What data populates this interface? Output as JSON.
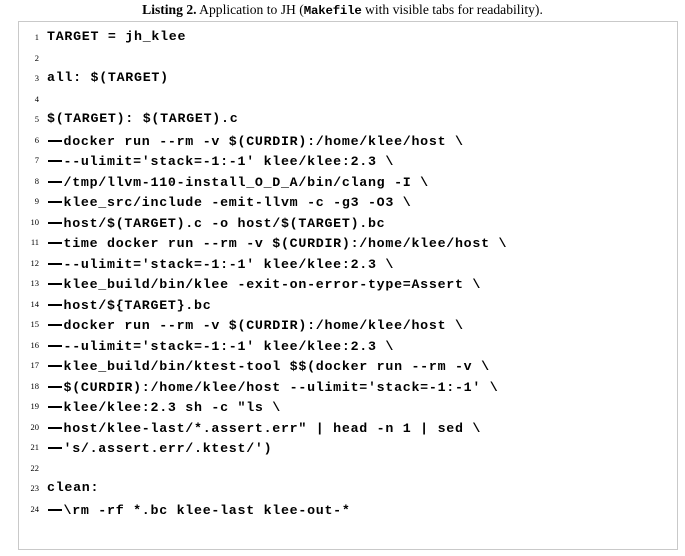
{
  "caption": {
    "label": "Listing 2.",
    "text_before_mono": " Application to JH (",
    "mono": "Makefile",
    "text_after_mono": " with visible tabs for readability)."
  },
  "listing": {
    "border_color": "#c9c9c9",
    "tab_glyph": "tab-marker",
    "lines": [
      {
        "n": "1",
        "tabs": 0,
        "text": "TARGET = jh_klee"
      },
      {
        "n": "2",
        "tabs": 0,
        "text": ""
      },
      {
        "n": "3",
        "tabs": 0,
        "text": "all: $(TARGET)"
      },
      {
        "n": "4",
        "tabs": 0,
        "text": ""
      },
      {
        "n": "5",
        "tabs": 0,
        "text": "$(TARGET): $(TARGET).c"
      },
      {
        "n": "6",
        "tabs": 1,
        "text": "docker run --rm -v $(CURDIR):/home/klee/host \\"
      },
      {
        "n": "7",
        "tabs": 1,
        "text": "--ulimit='stack=-1:-1' klee/klee:2.3 \\"
      },
      {
        "n": "8",
        "tabs": 1,
        "text": "/tmp/llvm-110-install_O_D_A/bin/clang -I \\"
      },
      {
        "n": "9",
        "tabs": 1,
        "text": "klee_src/include -emit-llvm -c -g3 -O3 \\"
      },
      {
        "n": "10",
        "tabs": 1,
        "text": "host/$(TARGET).c -o host/$(TARGET).bc"
      },
      {
        "n": "11",
        "tabs": 1,
        "text": "time docker run --rm -v $(CURDIR):/home/klee/host \\"
      },
      {
        "n": "12",
        "tabs": 1,
        "text": "--ulimit='stack=-1:-1' klee/klee:2.3 \\"
      },
      {
        "n": "13",
        "tabs": 1,
        "text": "klee_build/bin/klee -exit-on-error-type=Assert \\"
      },
      {
        "n": "14",
        "tabs": 1,
        "text": "host/${TARGET}.bc"
      },
      {
        "n": "15",
        "tabs": 1,
        "text": "docker run --rm -v $(CURDIR):/home/klee/host \\"
      },
      {
        "n": "16",
        "tabs": 1,
        "text": "--ulimit='stack=-1:-1' klee/klee:2.3 \\"
      },
      {
        "n": "17",
        "tabs": 1,
        "text": "klee_build/bin/ktest-tool $$(docker run --rm -v \\"
      },
      {
        "n": "18",
        "tabs": 1,
        "text": "$(CURDIR):/home/klee/host --ulimit='stack=-1:-1' \\"
      },
      {
        "n": "19",
        "tabs": 1,
        "text": "klee/klee:2.3 sh -c \"ls \\"
      },
      {
        "n": "20",
        "tabs": 1,
        "text": "host/klee-last/*.assert.err\" | head -n 1 | sed \\"
      },
      {
        "n": "21",
        "tabs": 1,
        "text": "'s/.assert.err/.ktest/')"
      },
      {
        "n": "22",
        "tabs": 0,
        "text": ""
      },
      {
        "n": "23",
        "tabs": 0,
        "text": "clean:"
      },
      {
        "n": "24",
        "tabs": 1,
        "text": "\\rm -rf *.bc klee-last klee-out-*"
      }
    ]
  }
}
